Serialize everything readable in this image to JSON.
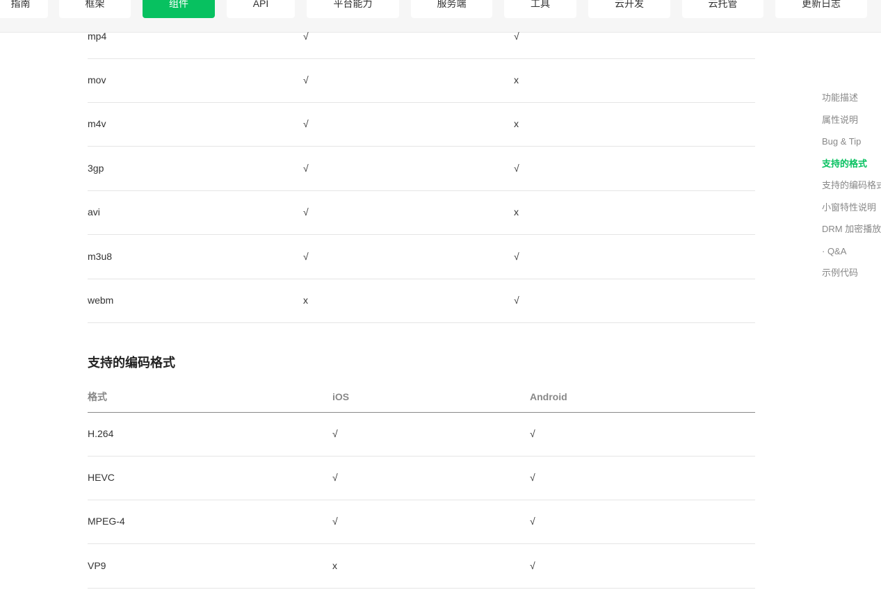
{
  "nav": {
    "tabs": [
      {
        "label": "指南",
        "active": false
      },
      {
        "label": "框架",
        "active": false
      },
      {
        "label": "组件",
        "active": true
      },
      {
        "label": "API",
        "active": false
      },
      {
        "label": "平台能力",
        "active": false
      },
      {
        "label": "服务端",
        "active": false
      },
      {
        "label": "工具",
        "active": false
      },
      {
        "label": "云开发",
        "active": false
      },
      {
        "label": "云托管",
        "active": false
      },
      {
        "label": "更新日志",
        "active": false
      }
    ]
  },
  "container_table": {
    "rows": [
      {
        "format": "mp4",
        "ios": "√",
        "android": "√"
      },
      {
        "format": "mov",
        "ios": "√",
        "android": "x"
      },
      {
        "format": "m4v",
        "ios": "√",
        "android": "x"
      },
      {
        "format": "3gp",
        "ios": "√",
        "android": "√"
      },
      {
        "format": "avi",
        "ios": "√",
        "android": "x"
      },
      {
        "format": "m3u8",
        "ios": "√",
        "android": "√"
      },
      {
        "format": "webm",
        "ios": "x",
        "android": "√"
      }
    ]
  },
  "codec_section": {
    "title": "支持的编码格式",
    "headers": {
      "format": "格式",
      "ios": "iOS",
      "android": "Android"
    },
    "rows": [
      {
        "format": "H.264",
        "ios": "√",
        "android": "√"
      },
      {
        "format": "HEVC",
        "ios": "√",
        "android": "√"
      },
      {
        "format": "MPEG-4",
        "ios": "√",
        "android": "√"
      },
      {
        "format": "VP9",
        "ios": "x",
        "android": "√"
      }
    ]
  },
  "toc": {
    "items": [
      {
        "label": "功能描述",
        "active": false
      },
      {
        "label": "属性说明",
        "active": false
      },
      {
        "label": "Bug & Tip",
        "active": false
      },
      {
        "label": "支持的格式",
        "active": true
      },
      {
        "label": "支持的编码格式",
        "active": false
      },
      {
        "label": "小窗特性说明",
        "active": false
      },
      {
        "label": "DRM 加密播放",
        "active": false
      },
      {
        "label": "· Q&A",
        "active": false
      },
      {
        "label": "示例代码",
        "active": false
      }
    ]
  },
  "colors": {
    "accent": "#07c160",
    "text": "#333333",
    "muted": "#888888"
  }
}
